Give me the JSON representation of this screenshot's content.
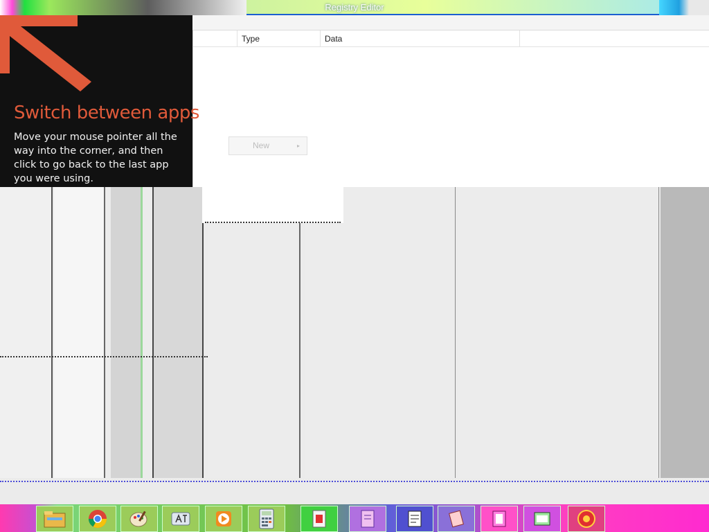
{
  "window": {
    "title": "Registry Editor"
  },
  "columns": {
    "type": "Type",
    "data": "Data"
  },
  "context_menu": {
    "new_label": "New",
    "arrow": "▸"
  },
  "tip": {
    "title": "Switch between apps",
    "body": "Move your mouse pointer all the way into the corner, and then click to go back to the last app you were using.",
    "accent_color": "#e05a3a"
  },
  "taskbar": {
    "items": [
      {
        "name": "file-explorer-icon"
      },
      {
        "name": "chrome-icon"
      },
      {
        "name": "paint-icon"
      },
      {
        "name": "language-icon"
      },
      {
        "name": "media-player-icon"
      },
      {
        "name": "calculator-icon"
      },
      {
        "name": "app-icon-7"
      },
      {
        "name": "app-icon-8"
      },
      {
        "name": "app-icon-9"
      },
      {
        "name": "app-icon-10"
      },
      {
        "name": "app-icon-11"
      },
      {
        "name": "app-icon-12"
      },
      {
        "name": "app-icon-13"
      }
    ]
  }
}
